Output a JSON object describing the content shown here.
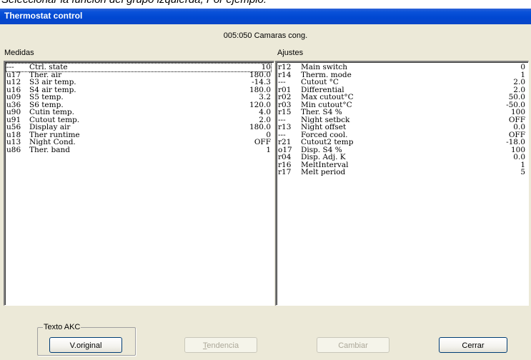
{
  "caption": "Seleccionar la función del grupo izquierda, Por ejemplo:",
  "window": {
    "title": "Thermostat control"
  },
  "device_label": "005:050  Camaras cong.",
  "left_panel": {
    "label": "Medidas",
    "rows": [
      {
        "code": "---",
        "name": "Ctrl. state",
        "value": "10"
      },
      {
        "code": "u17",
        "name": "Ther. air",
        "value": "180.0"
      },
      {
        "code": "u12",
        "name": "S3 air temp.",
        "value": "-14.3"
      },
      {
        "code": "u16",
        "name": "S4 air temp.",
        "value": "180.0"
      },
      {
        "code": "u09",
        "name": "S5 temp.",
        "value": "3.2"
      },
      {
        "code": "u36",
        "name": "S6 temp.",
        "value": "120.0"
      },
      {
        "code": "u90",
        "name": "Cutin temp.",
        "value": "4.0"
      },
      {
        "code": "u91",
        "name": "Cutout temp.",
        "value": "2.0"
      },
      {
        "code": "u56",
        "name": "Display air",
        "value": "180.0"
      },
      {
        "code": "u18",
        "name": "Ther runtime",
        "value": "0"
      },
      {
        "code": "u13",
        "name": "Night Cond.",
        "value": "OFF"
      },
      {
        "code": "u86",
        "name": "Ther. band",
        "value": "1"
      }
    ]
  },
  "right_panel": {
    "label": "Ajustes",
    "rows": [
      {
        "code": "r12",
        "name": "Main switch",
        "value": "0"
      },
      {
        "code": "r14",
        "name": "Therm. mode",
        "value": "1"
      },
      {
        "code": "---",
        "name": "Cutout °C",
        "value": "2.0"
      },
      {
        "code": "r01",
        "name": "Differential",
        "value": "2.0"
      },
      {
        "code": "r02",
        "name": "Max cutout°C",
        "value": "50.0"
      },
      {
        "code": "r03",
        "name": "Min cutout°C",
        "value": "-50.0"
      },
      {
        "code": "r15",
        "name": "Ther. S4 %",
        "value": "100"
      },
      {
        "code": "---",
        "name": "Night setbck",
        "value": "OFF"
      },
      {
        "code": "r13",
        "name": "Night offset",
        "value": "0.0"
      },
      {
        "code": "---",
        "name": "Forced cool.",
        "value": "OFF"
      },
      {
        "code": "r21",
        "name": "Cutout2 temp",
        "value": "-18.0"
      },
      {
        "code": "o17",
        "name": "Disp. S4 %",
        "value": "100"
      },
      {
        "code": "r04",
        "name": "Disp. Adj. K",
        "value": "0.0"
      },
      {
        "code": "r16",
        "name": "MeltInterval",
        "value": "1"
      },
      {
        "code": "r17",
        "name": "Melt period",
        "value": "5"
      }
    ]
  },
  "akc_group": {
    "label": "Texto AKC",
    "button": "V.original"
  },
  "buttons": {
    "tendencia": "Tendencia",
    "cambiar": "Cambiar",
    "cerrar": "Cerrar"
  }
}
